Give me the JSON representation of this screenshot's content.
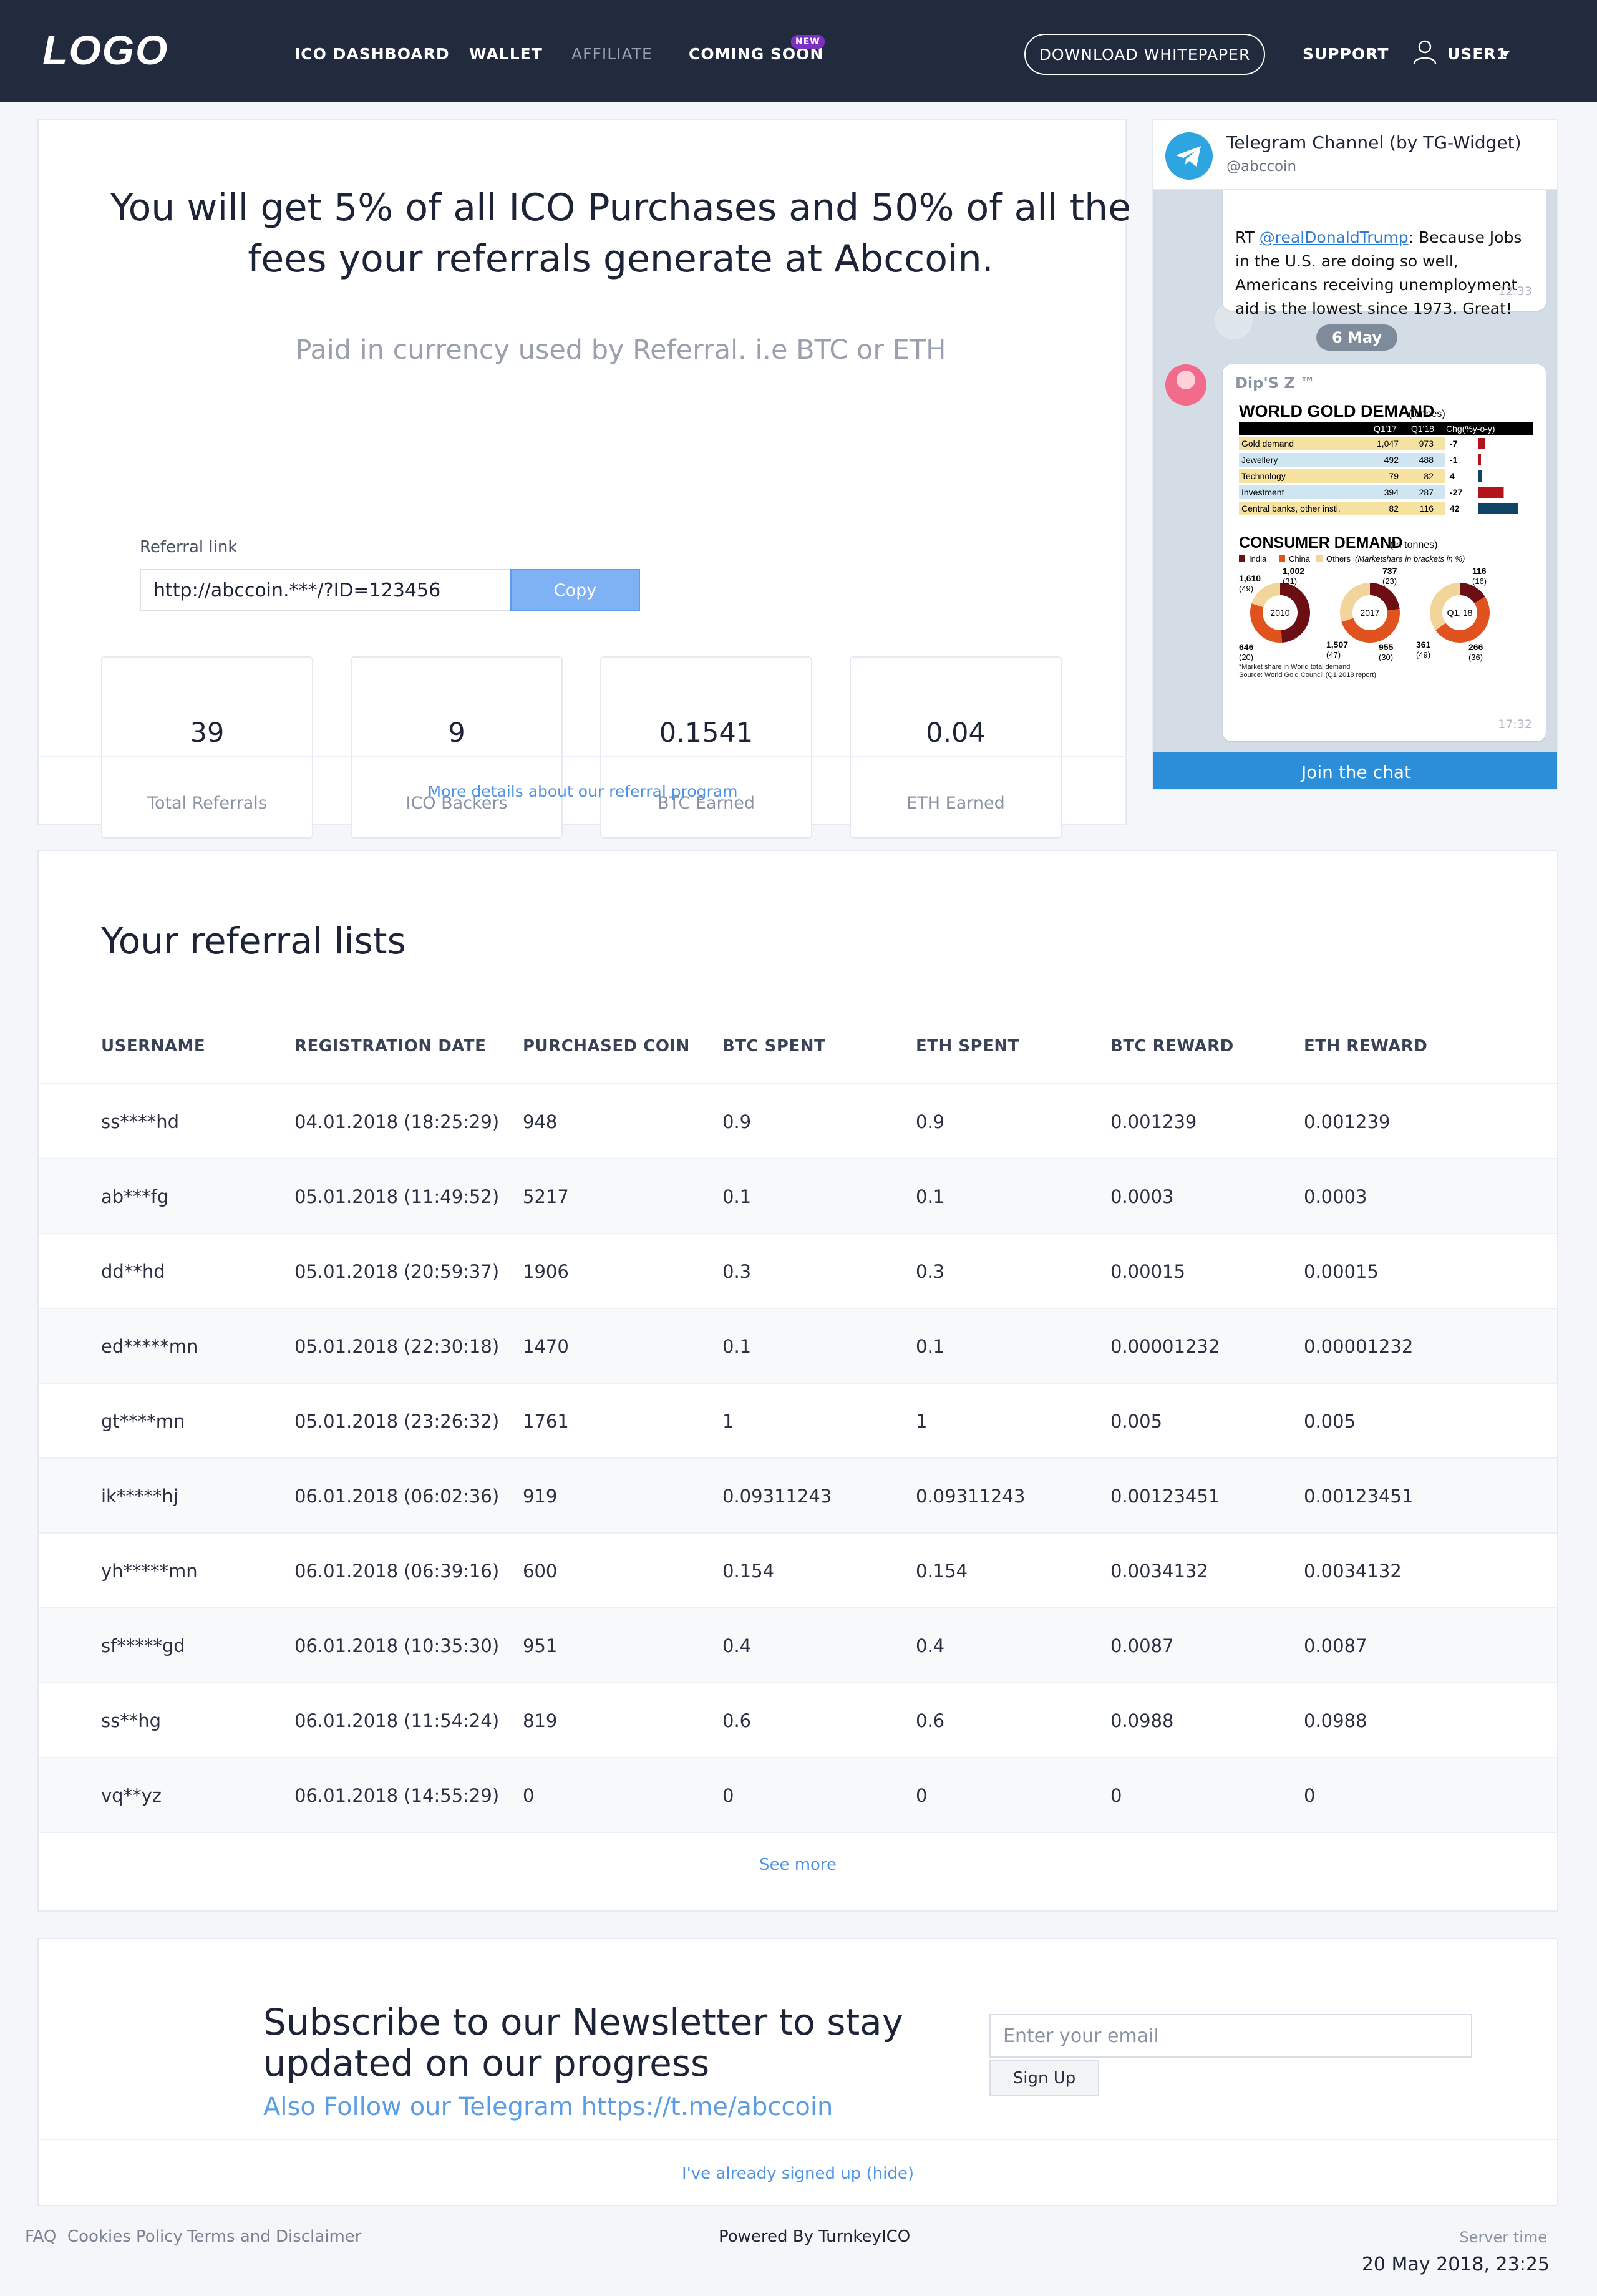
{
  "navbar": {
    "logo": "LOGO",
    "items": [
      "ICO DASHBOARD",
      "WALLET",
      "AFFILIATE",
      "COMING SOON"
    ],
    "new_badge": "NEW",
    "whitepaper": "DOWNLOAD WHITEPAPER",
    "support": "SUPPORT",
    "user": "USER1",
    "icons": [
      "user-icon",
      "chevron-down-icon"
    ]
  },
  "referral": {
    "headline": "You will get 5% of all ICO Purchases and 50% of all the fees your referrals generate at Abccoin.",
    "sub": "Paid in currency used by Referral. i.e BTC or ETH",
    "link_label": "Referral link",
    "link_value": "http://abccoin.***/?ID=123456",
    "copy": "Copy",
    "stats": [
      {
        "value": "39",
        "label": "Total Referrals"
      },
      {
        "value": "9",
        "label": "ICO Backers"
      },
      {
        "value": "0.1541",
        "label": "BTC Earned"
      },
      {
        "value": "0.04",
        "label": "ETH Earned"
      }
    ],
    "more": "More details about our referral program"
  },
  "telegram": {
    "title": "Telegram Channel (by TG-Widget)",
    "handle": "@abccoin",
    "msg1_prefix": "RT ",
    "msg1_link": "@realDonaldTrump",
    "msg1_rest": ": Because Jobs in the U.S. are doing so well, Americans receiving unemployment aid is the lowest since 1973. Great!",
    "msg1_time": "12:33",
    "date": "6 May",
    "msg2_author": "Dip'S Z ™",
    "msg2_time": "17:32",
    "join": "Join the chat",
    "infographic": {
      "title": "WORLD GOLD DEMAND",
      "title_unit": "(tonnes)",
      "cols": [
        "Q1'17",
        "Q1'18",
        "Chg(%y-o-y)"
      ],
      "rows": [
        {
          "name": "Gold demand",
          "q17": "1,047",
          "q18": "973",
          "chg": "-7",
          "bar": 7
        },
        {
          "name": "Jewellery",
          "q17": "492",
          "q18": "488",
          "chg": "-1",
          "bar": 1
        },
        {
          "name": "Technology",
          "q17": "79",
          "q18": "82",
          "chg": "4",
          "bar": 4
        },
        {
          "name": "Investment",
          "q17": "394",
          "q18": "287",
          "chg": "-27",
          "bar": 27
        },
        {
          "name": "Central banks, other insti.",
          "q17": "82",
          "q18": "116",
          "chg": "42",
          "bar": 42
        }
      ],
      "consumer_title": "CONSUMER DEMAND",
      "consumer_unit": "(In tonnes)",
      "legend": [
        "India",
        "China",
        "Others"
      ],
      "legend_note": "(Marketshare in brackets in %)",
      "donuts": [
        {
          "label": "2010",
          "top_left": "1,610",
          "top_left_pct": "(49)",
          "top_right": "1,002",
          "top_right_pct": "(31)",
          "bottom": "646",
          "bottom_pct": "(20)"
        },
        {
          "label": "2017",
          "top_left": "",
          "top_left_pct": "",
          "top_right": "737",
          "top_right_pct": "(23)",
          "bottom_left": "1,507",
          "bottom_left_pct": "(47)",
          "bottom": "955",
          "bottom_pct": "(30)"
        },
        {
          "label": "Q1,'18",
          "top_left": "",
          "top_left_pct": "",
          "top_right": "116",
          "top_right_pct": "(16)",
          "bottom_left": "361",
          "bottom_left_pct": "(49)",
          "bottom": "266",
          "bottom_pct": "(36)"
        }
      ],
      "footnote1": "*Market share in World total demand",
      "footnote2": "Source: World Gold Council (Q1 2018 report)",
      "colors": {
        "india": "#6b0f14",
        "china": "#e0531f",
        "others": "#f1d59a",
        "bar_neg": "#b3141c",
        "bar_pos": "#0e4466"
      }
    }
  },
  "table": {
    "title": "Your referral lists",
    "headers": [
      "USERNAME",
      "REGISTRATION DATE",
      "PURCHASED COIN",
      "BTC SPENT",
      "ETH SPENT",
      "BTC REWARD",
      "ETH REWARD"
    ],
    "rows": [
      [
        "ss****hd",
        "04.01.2018 (18:25:29)",
        "948",
        "0.9",
        "0.9",
        "0.001239",
        "0.001239"
      ],
      [
        "ab***fg",
        "05.01.2018 (11:49:52)",
        "5217",
        "0.1",
        "0.1",
        "0.0003",
        "0.0003"
      ],
      [
        "dd**hd",
        "05.01.2018 (20:59:37)",
        "1906",
        "0.3",
        "0.3",
        "0.00015",
        "0.00015"
      ],
      [
        "ed*****mn",
        "05.01.2018 (22:30:18)",
        "1470",
        "0.1",
        "0.1",
        "0.00001232",
        "0.00001232"
      ],
      [
        "gt****mn",
        "05.01.2018 (23:26:32)",
        "1761",
        "1",
        "1",
        "0.005",
        "0.005"
      ],
      [
        "ik*****hj",
        "06.01.2018 (06:02:36)",
        "919",
        "0.09311243",
        "0.09311243",
        "0.00123451",
        "0.00123451"
      ],
      [
        "yh*****mn",
        "06.01.2018 (06:39:16)",
        "600",
        "0.154",
        "0.154",
        "0.0034132",
        "0.0034132"
      ],
      [
        "sf*****gd",
        "06.01.2018 (10:35:30)",
        "951",
        "0.4",
        "0.4",
        "0.0087",
        "0.0087"
      ],
      [
        "ss**hg",
        "06.01.2018 (11:54:24)",
        "819",
        "0.6",
        "0.6",
        "0.0988",
        "0.0988"
      ],
      [
        "vq**yz",
        "06.01.2018 (14:55:29)",
        "0",
        "0",
        "0",
        "0",
        "0"
      ]
    ],
    "see_more": "See more"
  },
  "newsletter": {
    "title": "Subscribe to our Newsletter to stay updated on our progress",
    "follow": "Also Follow our Telegram https://t.me/abccoin",
    "email_placeholder": "Enter your email",
    "signup": "Sign Up",
    "hide": "I've already signed up (hide)"
  },
  "footer": {
    "links": [
      "FAQ",
      "Cookies Policy",
      "Terms and Disclaimer"
    ],
    "powered": "Powered By TurnkeyICO",
    "server_label": "Server time",
    "server_time": "20 May 2018, 23:25"
  }
}
